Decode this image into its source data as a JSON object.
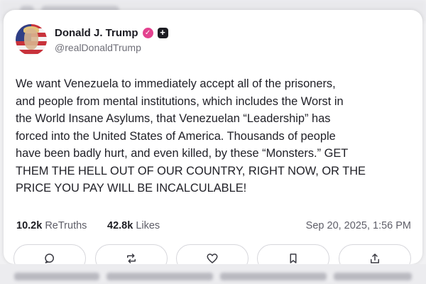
{
  "post": {
    "author_name": "Donald J. Trump",
    "handle": "@realDonaldTrump",
    "text": "We want Venezuela to immediately accept all of the prisoners,\nand people from mental institutions, which includes the Worst in\nthe World Insane Asylums, that Venezuelan “Leadership” has\nforced into the United States of America. Thousands of people\nhave been badly hurt, and even killed, by these “Monsters.” GET\nTHEM THE HELL OUT OF OUR COUNTRY, RIGHT NOW, OR THE\nPRICE YOU PAY WILL BE INCALCULABLE!",
    "retruths_count": "10.2k",
    "retruths_label": "ReTruths",
    "likes_count": "42.8k",
    "likes_label": "Likes",
    "timestamp": "Sep 20, 2025, 1:56 PM"
  },
  "badges": {
    "verified_icon": "verified-check-icon",
    "verified_color": "#e3428f",
    "plus_icon": "plus-icon"
  },
  "actions": [
    {
      "name": "reply",
      "icon": "comment-icon"
    },
    {
      "name": "retruth",
      "icon": "repost-icon"
    },
    {
      "name": "like",
      "icon": "heart-icon"
    },
    {
      "name": "bookmark",
      "icon": "bookmark-icon"
    },
    {
      "name": "share",
      "icon": "share-icon"
    }
  ]
}
